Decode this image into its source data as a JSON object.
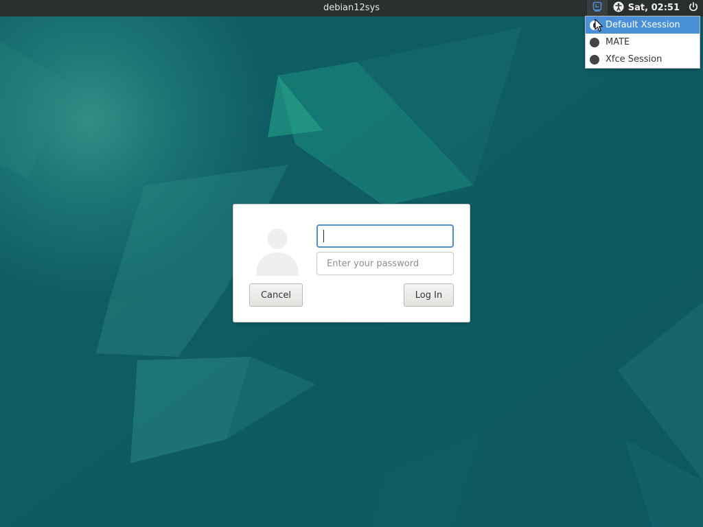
{
  "top_panel": {
    "hostname": "debian12sys",
    "clock": "Sat, 02:51",
    "icons": {
      "session": "session-selector-icon",
      "accessibility": "accessibility-icon",
      "power": "power-icon"
    }
  },
  "session_menu": {
    "items": [
      {
        "label": "Default Xsession",
        "selected": true
      },
      {
        "label": "MATE",
        "selected": false
      },
      {
        "label": "Xfce Session",
        "selected": false
      }
    ]
  },
  "login": {
    "username_value": "",
    "password_placeholder": "Enter your password",
    "cancel_label": "Cancel",
    "login_label": "Log In"
  },
  "colors": {
    "panel": "#2b2e2f",
    "accent": "#4a90d9",
    "wallpaper": "#0e5a63"
  }
}
